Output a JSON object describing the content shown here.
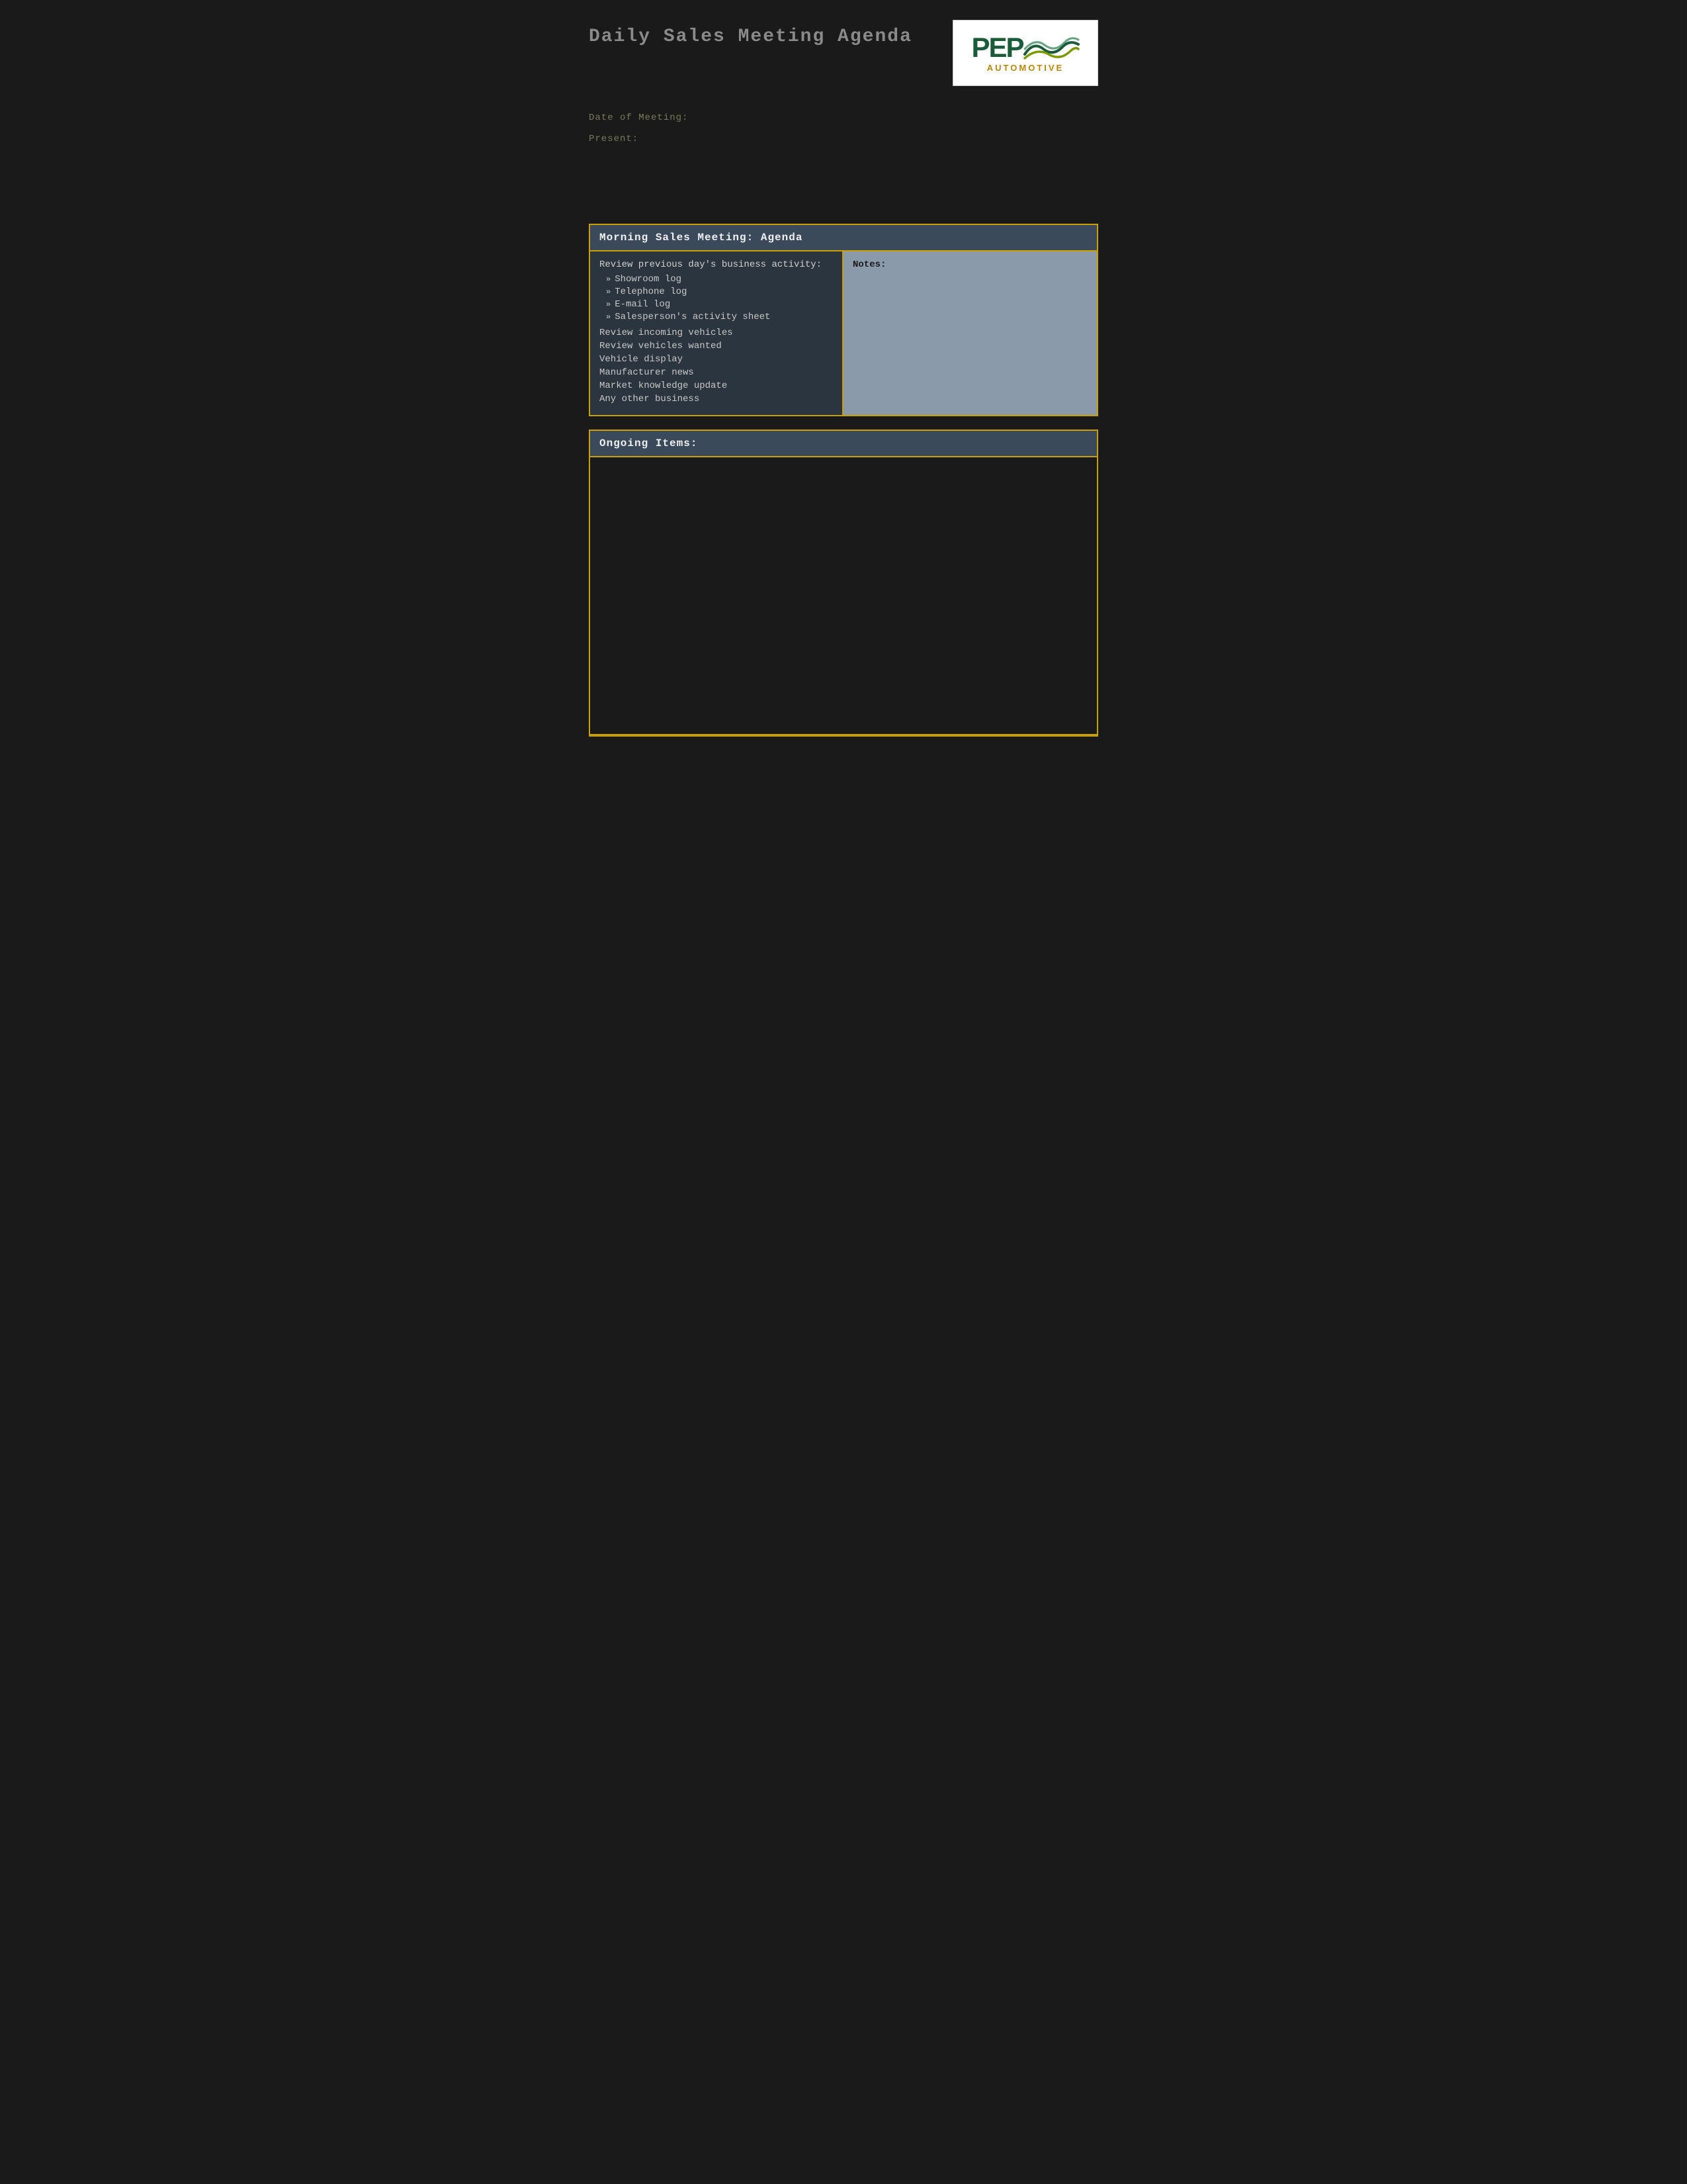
{
  "page": {
    "title": "Daily Sales Meeting Agenda",
    "background_color": "#1a1a1a"
  },
  "logo": {
    "text_pep": "PEP",
    "text_automotive": "AUTOMOTIVE",
    "alt": "PEP Automotive Logo"
  },
  "meta": {
    "date_label": "Date of Meeting:",
    "present_label": "Present:"
  },
  "morning_section": {
    "header": "Morning Sales Meeting: Agenda",
    "review_title": "Review previous day's business activity:",
    "sub_items": [
      "Showroom log",
      "Telephone log",
      "E-mail log",
      "Salesperson's activity sheet"
    ],
    "agenda_items": [
      "Review incoming vehicles",
      "Review vehicles wanted",
      "Vehicle display",
      "Manufacturer news",
      "Market knowledge update",
      "Any other business"
    ],
    "notes_label": "Notes:"
  },
  "ongoing_section": {
    "header": "Ongoing Items:"
  }
}
